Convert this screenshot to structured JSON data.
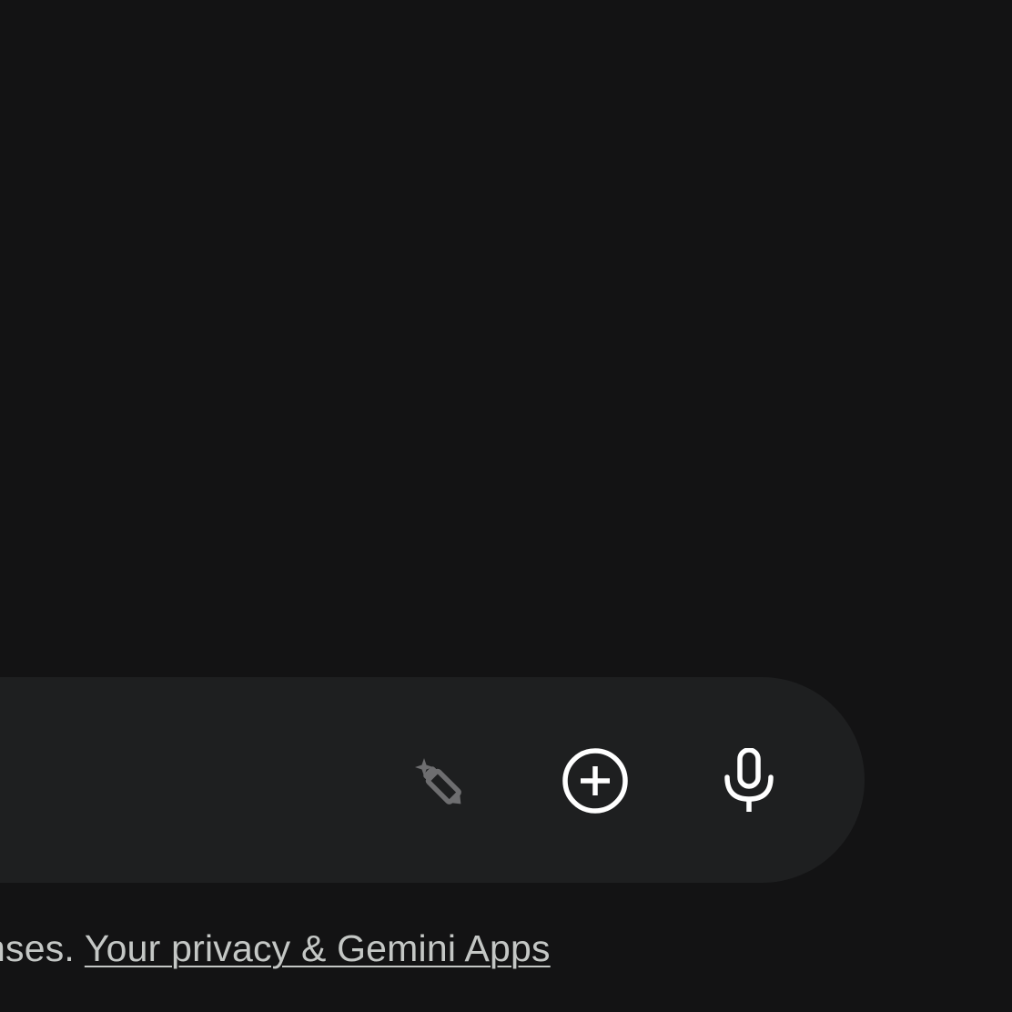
{
  "composer": {
    "refine_icon": "pencil-sparkle-icon",
    "add_icon": "add-circle-icon",
    "mic_icon": "microphone-icon"
  },
  "footer": {
    "text_prefix": "onses. ",
    "privacy_link": "Your privacy & Gemini Apps"
  },
  "colors": {
    "background": "#131314",
    "input_bar": "#1e1f20",
    "icon_active": "#ffffff",
    "icon_disabled": "#6e6e70",
    "footer_text": "#c4c7c5"
  }
}
